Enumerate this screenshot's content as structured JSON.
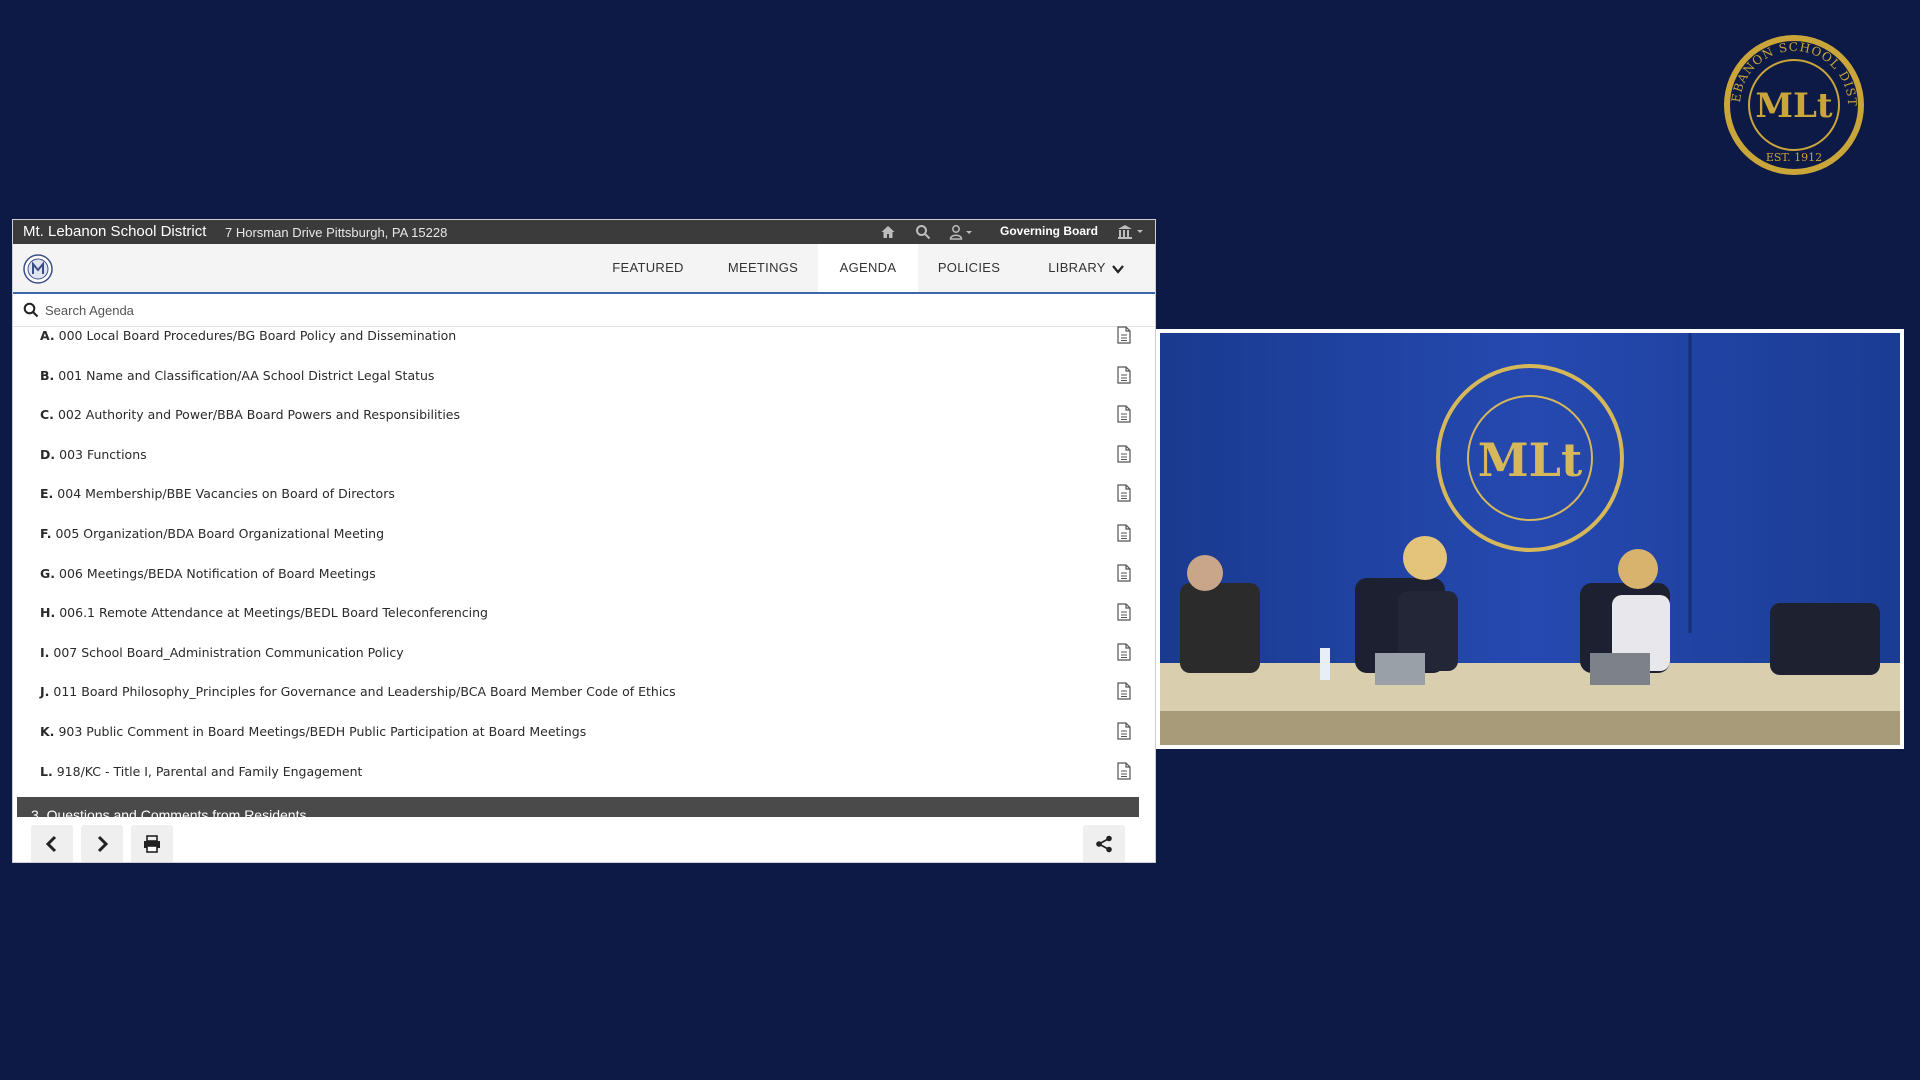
{
  "seal": {
    "top_arc": "MT. LEBANON SCHOOL DISTRICT",
    "monogram": "MLt",
    "est": "EST. 1912"
  },
  "topbar": {
    "org_name": "Mt. Lebanon School District",
    "address": "7 Horsman Drive Pittsburgh, PA 15228",
    "governing_label": "Governing Board",
    "icons": [
      "home-icon",
      "search-icon",
      "user-icon",
      "building-icon"
    ]
  },
  "nav": {
    "tabs": [
      {
        "label": "FEATURED"
      },
      {
        "label": "MEETINGS"
      },
      {
        "label": "AGENDA",
        "active": true
      },
      {
        "label": "POLICIES"
      },
      {
        "label": "LIBRARY"
      }
    ]
  },
  "search": {
    "placeholder": "Search Agenda"
  },
  "agenda": {
    "items": [
      {
        "letter": "A.",
        "text": "000 Local Board Procedures/BG Board Policy and Dissemination"
      },
      {
        "letter": "B.",
        "text": "001 Name and Classification/AA School District Legal Status"
      },
      {
        "letter": "C.",
        "text": "002 Authority and Power/BBA Board Powers and Responsibilities"
      },
      {
        "letter": "D.",
        "text": "003 Functions"
      },
      {
        "letter": "E.",
        "text": "004 Membership/BBE Vacancies on Board of Directors"
      },
      {
        "letter": "F.",
        "text": "005 Organization/BDA Board Organizational Meeting"
      },
      {
        "letter": "G.",
        "text": "006 Meetings/BEDA Notification of Board Meetings"
      },
      {
        "letter": "H.",
        "text": "006.1 Remote Attendance at Meetings/BEDL Board Teleconferencing"
      },
      {
        "letter": "I.",
        "text": "007 School Board_Administration Communication Policy"
      },
      {
        "letter": "J.",
        "text": "011 Board Philosophy_Principles for Governance and Leadership/BCA Board Member Code of Ethics"
      },
      {
        "letter": "K.",
        "text": "903 Public Comment in Board Meetings/BEDH Public Participation at Board Meetings"
      },
      {
        "letter": "L.",
        "text": "918/KC - Title I, Parental and Family Engagement"
      }
    ],
    "next_section": "3. Questions and Comments from Residents"
  },
  "footer": {
    "icons": [
      "prev-icon",
      "next-icon",
      "print-icon",
      "share-icon"
    ]
  },
  "colors": {
    "background": "#0c1a45",
    "topbar": "#3b3b3b",
    "accent": "#3b66a8",
    "seal_gold": "#c9a53a",
    "video_wall": "#1f3f9e"
  }
}
